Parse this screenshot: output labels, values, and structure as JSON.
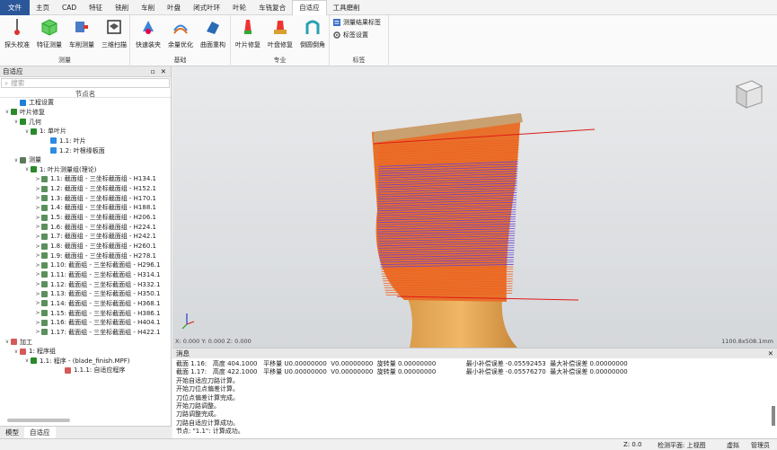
{
  "menubar": {
    "items": [
      "文件",
      "主页",
      "CAD",
      "特征",
      "铣削",
      "车削",
      "叶盘",
      "闭式叶环",
      "叶轮",
      "车铣复合",
      "自适应",
      "工具磨削"
    ],
    "active": "自适应"
  },
  "ribbon": {
    "groups": [
      {
        "label": "测量",
        "buttons": [
          "探头校准",
          "特征测量",
          "车削测量",
          "三维扫描"
        ]
      },
      {
        "label": "基础",
        "buttons": [
          "快速装夹",
          "余量优化",
          "曲面重构"
        ]
      },
      {
        "label": "专业",
        "buttons": [
          "叶片修复",
          "叶盘修复",
          "倒圆倒角"
        ]
      },
      {
        "label": "标签",
        "small": [
          "测量结果标签",
          "标签设置"
        ]
      }
    ]
  },
  "panel": {
    "title": "自适应",
    "search_placeholder": "搜索",
    "column": "节点名"
  },
  "tree": [
    {
      "label": "工程设置",
      "color": "#1e7fd6"
    },
    {
      "label": "叶片修复",
      "color": "#2a8a2a"
    },
    {
      "label": "几何",
      "color": "#2a8a2a"
    },
    {
      "label": "1: 单叶片",
      "color": "#2a8a2a"
    },
    {
      "label": "1.1: 叶片",
      "color": "#2e8be0"
    },
    {
      "label": "1.2: 叶根缘板面",
      "color": "#2e8be0"
    },
    {
      "label": "测量",
      "color": "#5a7a5a"
    },
    {
      "label": "1: 叶片测量组(理论)",
      "color": "#2a8a2a"
    },
    {
      "label": "1.1: 截面组 - 三坐标截面组 - H134.1",
      "color": "#5b8f5b"
    },
    {
      "label": "1.2: 截面组 - 三坐标截面组 - H152.1",
      "color": "#5b8f5b"
    },
    {
      "label": "1.3: 截面组 - 三坐标截面组 - H170.1",
      "color": "#5b8f5b"
    },
    {
      "label": "1.4: 截面组 - 三坐标截面组 - H188.1",
      "color": "#5b8f5b"
    },
    {
      "label": "1.5: 截面组 - 三坐标截面组 - H206.1",
      "color": "#5b8f5b"
    },
    {
      "label": "1.6: 截面组 - 三坐标截面组 - H224.1",
      "color": "#5b8f5b"
    },
    {
      "label": "1.7: 截面组 - 三坐标截面组 - H242.1",
      "color": "#5b8f5b"
    },
    {
      "label": "1.8: 截面组 - 三坐标截面组 - H260.1",
      "color": "#5b8f5b"
    },
    {
      "label": "1.9: 截面组 - 三坐标截面组 - H278.1",
      "color": "#5b8f5b"
    },
    {
      "label": "1.10: 截面组 - 三坐标截面组 - H296.1",
      "color": "#5b8f5b"
    },
    {
      "label": "1.11: 截面组 - 三坐标截面组 - H314.1",
      "color": "#5b8f5b"
    },
    {
      "label": "1.12: 截面组 - 三坐标截面组 - H332.1",
      "color": "#5b8f5b"
    },
    {
      "label": "1.13: 截面组 - 三坐标截面组 - H350.1",
      "color": "#5b8f5b"
    },
    {
      "label": "1.14: 截面组 - 三坐标截面组 - H368.1",
      "color": "#5b8f5b"
    },
    {
      "label": "1.15: 截面组 - 三坐标截面组 - H386.1",
      "color": "#5b8f5b"
    },
    {
      "label": "1.16: 截面组 - 三坐标截面组 - H404.1",
      "color": "#5b8f5b"
    },
    {
      "label": "1.17: 截面组 - 三坐标截面组 - H422.1",
      "color": "#5b8f5b"
    },
    {
      "label": "加工",
      "color": "#d45a5a"
    },
    {
      "label": "1: 程序组",
      "color": "#d45a5a"
    },
    {
      "label": "1.1: 程序 - (blade_finish.MPF)",
      "color": "#2a8a2a"
    },
    {
      "label": "1.1.1: 自适应程序",
      "color": "#d45a5a"
    }
  ],
  "bottom_tabs": [
    "模型",
    "自适应"
  ],
  "viewport": {
    "coords": "X: 0.000  Y: 0.000  Z: 0.000",
    "size": "1100.8x508.1mm"
  },
  "messages": {
    "title": "消息",
    "lines": [
      "截面 1.16:   高度 404.1000   平移量 U0.00000000  V0.00000000  旋转量 0.00000000               最小补偿误差 -0.05592453  最大补偿误差 0.00000000",
      "截面 1.17:   高度 422.1000   平移量 U0.00000000  V0.00000000  旋转量 0.00000000               最小补偿误差 -0.05576270  最大补偿误差 0.00000000",
      "开始自适应刀路计算。",
      "开始刀位点偏差计算。",
      "刀位点偏差计算完成。",
      "开始刀路调整。",
      "刀路调整完成。",
      "刀路自适应计算成功。",
      "节点: \"1.1\": 计算成功。"
    ]
  },
  "status": {
    "z": "Z: 0.0",
    "plane": "检测平面: 上视图",
    "mode": "虚拟",
    "user": "管理员"
  }
}
